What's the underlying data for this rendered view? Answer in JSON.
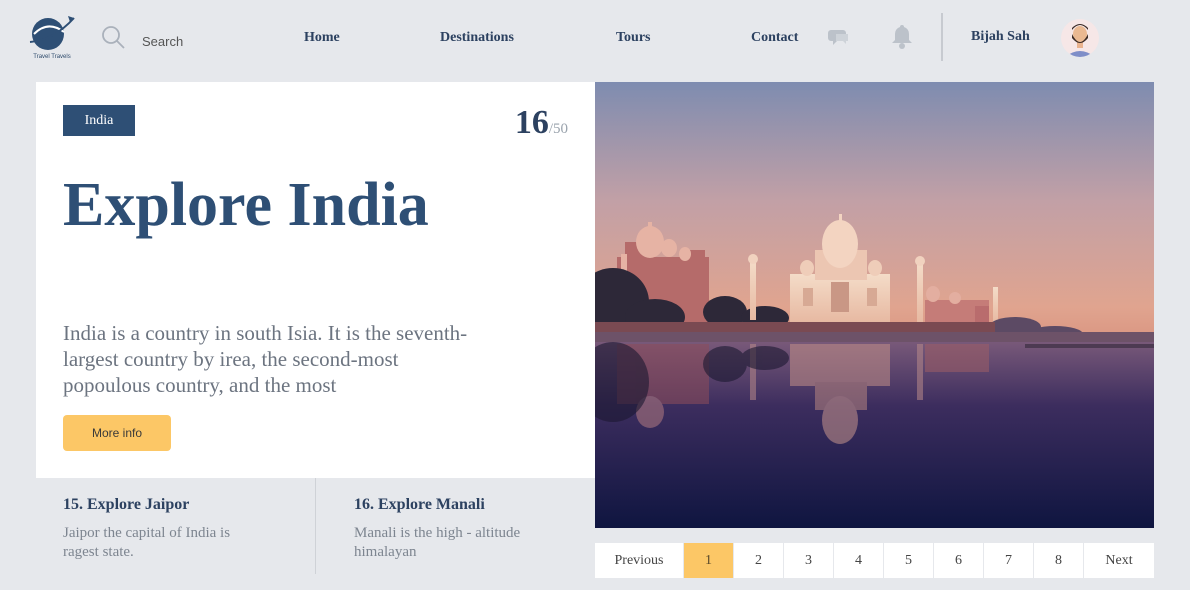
{
  "brand": {
    "logo_text": "Travel Travels"
  },
  "search": {
    "placeholder": "Search"
  },
  "nav": {
    "home": "Home",
    "destinations": "Destinations",
    "tours": "Tours",
    "contact": "Contact"
  },
  "user": {
    "name": "Bijah Sah"
  },
  "hero": {
    "badge": "India",
    "counter_current": "16",
    "counter_total": "/50",
    "title": "Explore India",
    "description": "India is a country in south Isia. It is the seventh-largest country by irea, the second-most popoulous country, and the most",
    "button_label": "More info"
  },
  "related": [
    {
      "title": "15. Explore Jaipor",
      "description": "Jaipor the capital of India is ragest state."
    },
    {
      "title": "16. Explore Manali",
      "description": "Manali is the high - altitude himalayan"
    }
  ],
  "pagination": {
    "previous": "Previous",
    "next": "Next",
    "pages": [
      "1",
      "2",
      "3",
      "4",
      "5",
      "6",
      "7",
      "8"
    ],
    "active_page": "1"
  },
  "colors": {
    "primary": "#2e4f75",
    "accent": "#fcc766",
    "background": "#e6e8ec"
  },
  "icons": [
    "logo-icon",
    "search-icon",
    "chat-icon",
    "bell-icon",
    "avatar"
  ]
}
